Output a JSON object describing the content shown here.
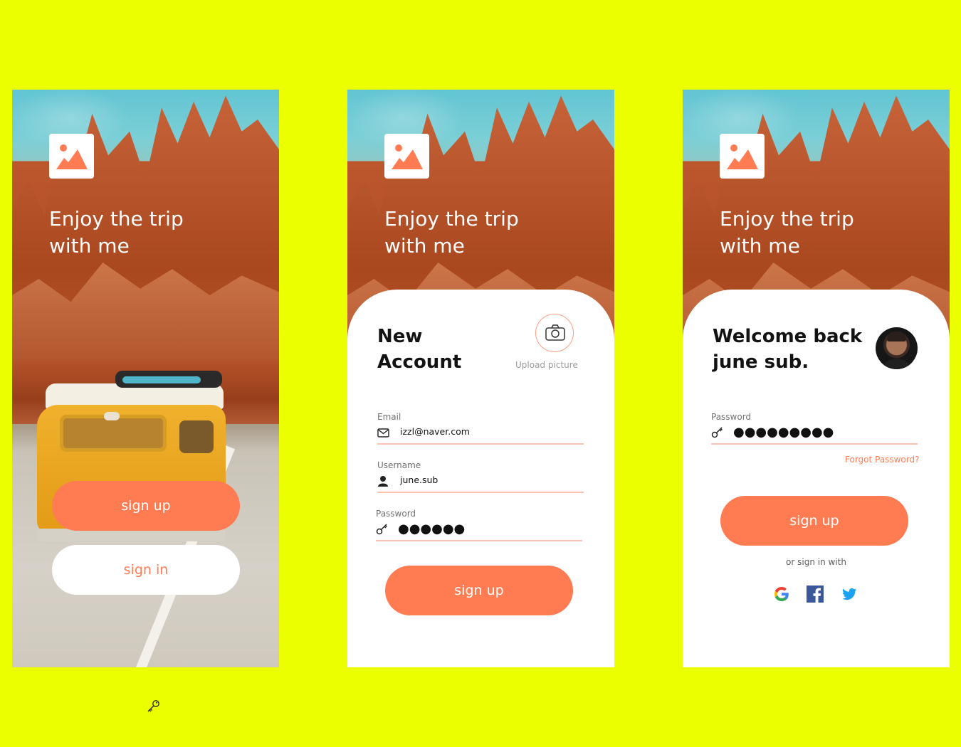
{
  "colors": {
    "background": "#ecff00",
    "accent": "#ff7b52",
    "white": "#ffffff"
  },
  "hero": {
    "title_line1": "Enjoy the trip",
    "title_line2": "with me"
  },
  "screen1": {
    "signup_label": "sign up",
    "signin_label": "sign in"
  },
  "screen2": {
    "title_line1": "New",
    "title_line2": "Account",
    "upload_label": "Upload picture",
    "email": {
      "label": "Email",
      "value": "izzl@naver.com",
      "icon": "mail-icon"
    },
    "username": {
      "label": "Username",
      "value": "june.sub",
      "icon": "user-icon"
    },
    "password": {
      "label": "Password",
      "value": "●●●●●●",
      "icon": "key-icon"
    },
    "signup_label": "sign up"
  },
  "screen3": {
    "title_line1": "Welcome back",
    "title_line2": "june sub.",
    "password": {
      "label": "Password",
      "value": "●●●●●●●●●",
      "icon": "key-icon"
    },
    "forgot_label": "Forgot Password?",
    "signup_label": "sign up",
    "or_label": "or sign in with",
    "social": [
      "google-icon",
      "facebook-icon",
      "twitter-icon"
    ]
  }
}
